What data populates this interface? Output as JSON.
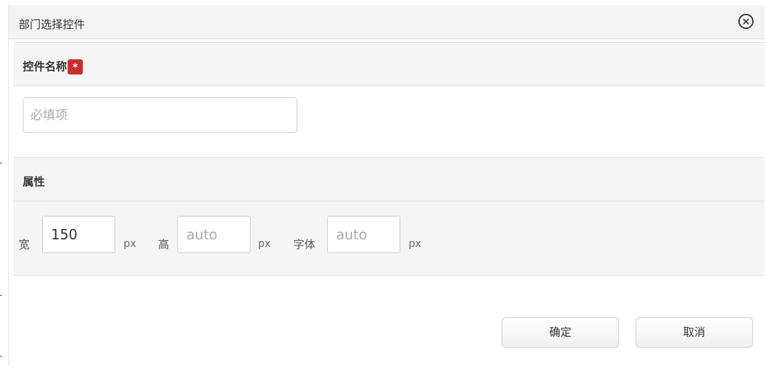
{
  "dialog": {
    "title": "部门选择控件",
    "close_symbol": "×"
  },
  "name_section": {
    "label": "控件名称",
    "required_mark": "*",
    "input_placeholder": "必填项",
    "input_value": ""
  },
  "props_section": {
    "label": "属性",
    "width": {
      "label": "宽",
      "value": "150",
      "placeholder": "",
      "unit": "px"
    },
    "height": {
      "label": "高",
      "value": "",
      "placeholder": "auto",
      "unit": "px"
    },
    "font": {
      "label": "字体",
      "value": "",
      "placeholder": "auto",
      "unit": "px"
    }
  },
  "footer": {
    "confirm_label": "确定",
    "cancel_label": "取消"
  },
  "colors": {
    "required_badge": "#c9302c",
    "header_bg": "#f3f3f3",
    "panel_bg": "#f5f5f5"
  }
}
